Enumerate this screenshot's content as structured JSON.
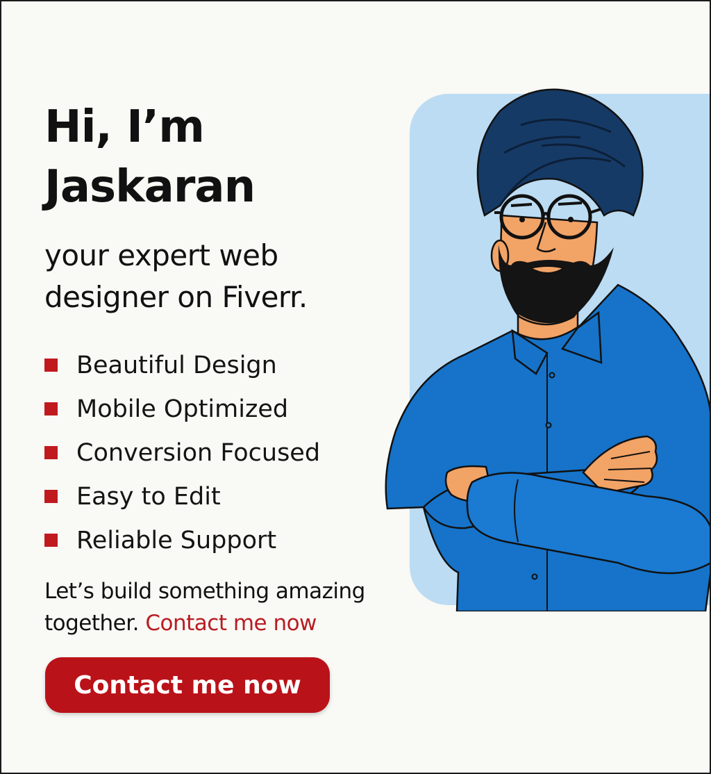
{
  "headline": {
    "line1": "Hi, I’m",
    "line2": "Jaskaran"
  },
  "subtitle": {
    "line1": "your expert web",
    "line2": "designer on Fiverr."
  },
  "features": [
    "Beautiful Design",
    "Mobile Optimized",
    "Conversion Focused",
    "Easy to Edit",
    "Reliable Support"
  ],
  "cta": {
    "text": "Let’s build something amazing together.",
    "link": "Contact me now",
    "button": "Contact me now"
  },
  "colors": {
    "accent_red": "#ba1219",
    "panel_bg": "#bcdcf3",
    "shirt_blue": "#1673c9",
    "turban_navy": "#163a66",
    "skin": "#f2a366"
  },
  "illustration": {
    "subject": "man-with-turban-and-glasses-arms-crossed"
  }
}
